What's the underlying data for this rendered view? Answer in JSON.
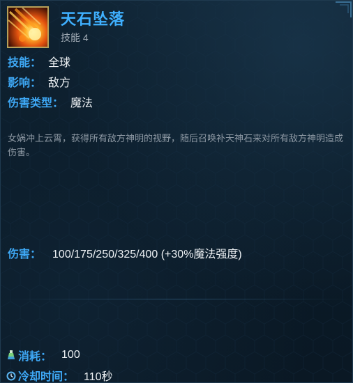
{
  "skill": {
    "name": "天石坠落",
    "slot": "技能 4",
    "icon": "meteor-fire-icon"
  },
  "attributes": [
    {
      "key": "技能：",
      "value": "全球"
    },
    {
      "key": "影响：",
      "value": "敌方"
    },
    {
      "key": "伤害类型：",
      "value": "魔法"
    }
  ],
  "description": "女娲冲上云霄，获得所有敌方神明的视野，随后召唤补天神石来对所有敌方神明造成伤害。",
  "damage": {
    "key": "伤害：",
    "value": "100/175/250/325/400 (+30%魔法强度)"
  },
  "cost": {
    "key": "消耗：",
    "value": "100",
    "icon": "mana-flask-icon"
  },
  "cooldown": {
    "key": "冷却时间：",
    "value": "110秒",
    "icon": "cooldown-clock-icon"
  },
  "colors": {
    "accent": "#3fb0ff",
    "label": "#3ea8f5",
    "text": "#eef2f5",
    "description": "#8d98a3",
    "background": "#0c1a26"
  }
}
